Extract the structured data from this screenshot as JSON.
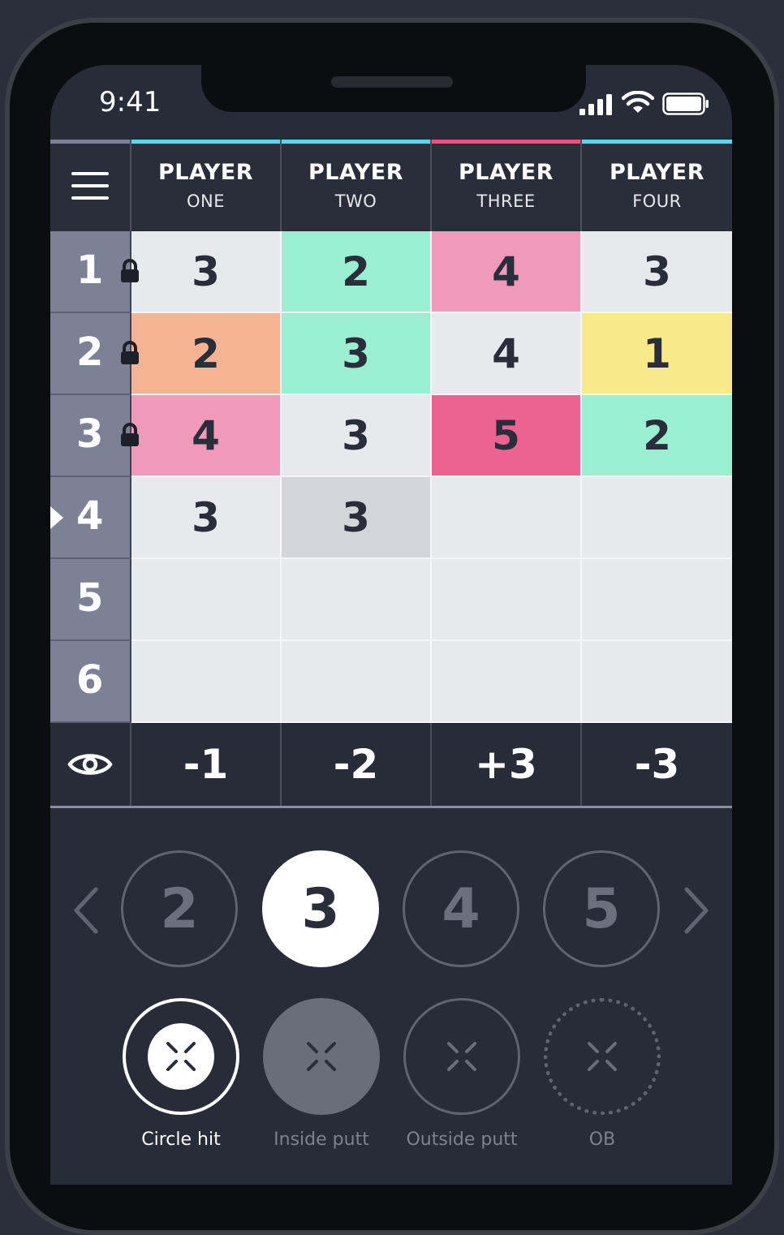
{
  "status": {
    "time": "9:41"
  },
  "header": {
    "players": [
      {
        "line1": "PLAYER",
        "line2": "ONE",
        "color": "#5fd4ee"
      },
      {
        "line1": "PLAYER",
        "line2": "TWO",
        "color": "#5fd4ee"
      },
      {
        "line1": "PLAYER",
        "line2": "THREE",
        "color": "#e8537f"
      },
      {
        "line1": "PLAYER",
        "line2": "FOUR",
        "color": "#5fd4ee"
      }
    ]
  },
  "holes": [
    {
      "number": "1",
      "locked": true,
      "current": false,
      "scores": [
        "3",
        "2",
        "4",
        "3"
      ]
    },
    {
      "number": "2",
      "locked": true,
      "current": false,
      "scores": [
        "2",
        "3",
        "4",
        "1"
      ]
    },
    {
      "number": "3",
      "locked": true,
      "current": false,
      "scores": [
        "4",
        "3",
        "5",
        "2"
      ]
    },
    {
      "number": "4",
      "locked": false,
      "current": true,
      "scores": [
        "3",
        "3",
        "",
        ""
      ]
    },
    {
      "number": "5",
      "locked": false,
      "current": false,
      "scores": [
        "",
        "",
        "",
        ""
      ]
    },
    {
      "number": "6",
      "locked": false,
      "current": false,
      "scores": [
        "",
        "",
        "",
        ""
      ]
    }
  ],
  "cell_colors": [
    [
      "#e8e9ec",
      "#9aeed2",
      "#f09ab9",
      "#e8e9ec"
    ],
    [
      "#f4b493",
      "#9aeed2",
      "#e8e9ec",
      "#f8e98a"
    ],
    [
      "#f09ab9",
      "#e8e9ec",
      "#ec6391",
      "#9aeed2"
    ],
    [
      "#e8e9ec",
      "#d2d5da",
      "#e8e9ec",
      "#e8e9ec"
    ],
    [
      "#e8e9ec",
      "#e8e9ec",
      "#e8e9ec",
      "#e8e9ec"
    ],
    [
      "#e8e9ec",
      "#e8e9ec",
      "#e8e9ec",
      "#e8e9ec"
    ]
  ],
  "totals": [
    "-1",
    "-2",
    "+3",
    "-3"
  ],
  "picker": {
    "options": [
      "2",
      "3",
      "4",
      "5"
    ],
    "selected": "3"
  },
  "actions": [
    {
      "label": "Circle hit",
      "active": true
    },
    {
      "label": "Inside putt",
      "active": false
    },
    {
      "label": "Outside putt",
      "active": false
    },
    {
      "label": "OB",
      "active": false
    }
  ]
}
